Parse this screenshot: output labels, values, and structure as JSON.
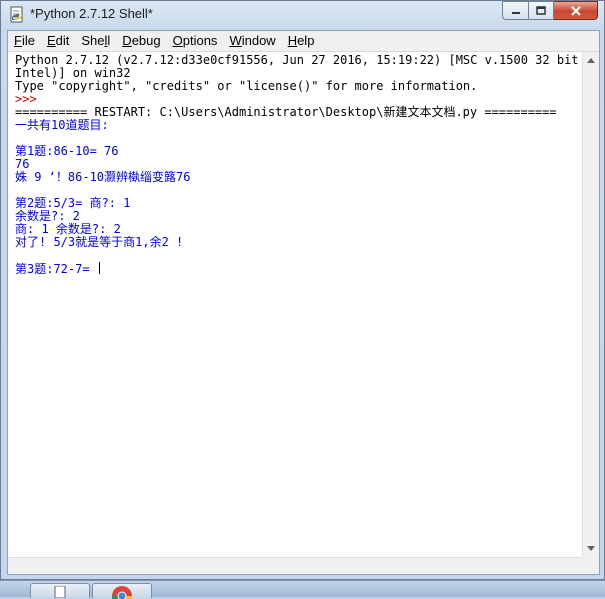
{
  "window": {
    "title": "*Python 2.7.12 Shell*",
    "minimize_icon": "minimize-icon",
    "maximize_icon": "maximize-icon",
    "close_icon": "close-icon"
  },
  "menu": [
    {
      "label": "File",
      "u": "F",
      "rest": "ile"
    },
    {
      "label": "Edit",
      "u": "E",
      "rest": "dit"
    },
    {
      "label": "Shell",
      "pre": "She",
      "u": "l",
      "rest": "l"
    },
    {
      "label": "Debug",
      "u": "D",
      "rest": "ebug"
    },
    {
      "label": "Options",
      "u": "O",
      "rest": "ptions"
    },
    {
      "label": "Window",
      "u": "W",
      "rest": "indow"
    },
    {
      "label": "Help",
      "u": "H",
      "rest": "elp"
    }
  ],
  "shell": {
    "lines": [
      {
        "text": "Python 2.7.12 (v2.7.12:d33e0cf91556, Jun 27 2016, 15:19:22) [MSC v.1500 32 bit (",
        "color": "black"
      },
      {
        "text": "Intel)] on win32",
        "color": "black"
      },
      {
        "text": "Type \"copyright\", \"credits\" or \"license()\" for more information.",
        "color": "black"
      },
      {
        "text": ">>> ",
        "color": "red"
      },
      {
        "text": "========== RESTART: C:\\Users\\Administrator\\Desktop\\新建文本文档.py ==========",
        "color": "black"
      },
      {
        "text": "一共有10道题目:",
        "color": "blue"
      },
      {
        "text": "",
        "color": "black"
      },
      {
        "text": "第1题:86-10= 76",
        "color": "blue"
      },
      {
        "text": "76",
        "color": "blue"
      },
      {
        "text": "姝 9 ‘！86-10灏辨槸缁变簬76",
        "color": "blue"
      },
      {
        "text": "",
        "color": "black"
      },
      {
        "text": "第2题:5/3= 商?: 1",
        "color": "blue"
      },
      {
        "text": "余数是?: 2",
        "color": "blue"
      },
      {
        "text": "商: 1 余数是?: 2",
        "color": "blue"
      },
      {
        "text": "对了! 5/3就是等于商1,余2 !",
        "color": "blue"
      },
      {
        "text": "",
        "color": "black"
      },
      {
        "text": "第3题:72-7= ",
        "color": "blue"
      }
    ]
  }
}
